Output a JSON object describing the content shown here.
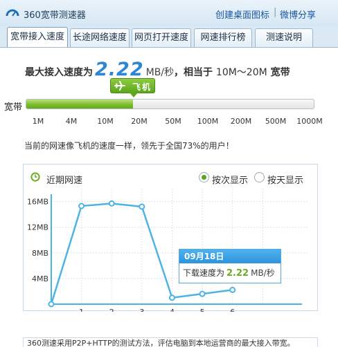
{
  "window": {
    "title": "360宽带测速器",
    "links": [
      "创建桌面图标",
      "微博分享"
    ],
    "link_separator": "|"
  },
  "tabs": [
    "宽带接入速度",
    "长途网络速度",
    "网页打开速度",
    "网速排行榜",
    "测速说明"
  ],
  "active_tab": 0,
  "summary": {
    "prefix": "最大接入速度为",
    "speed": "2.22",
    "unit": "MB/秒",
    "middle": "，相当于",
    "range": "10M～20M",
    "suffix": "宽带"
  },
  "badge": {
    "label": "飞机",
    "icon": "airplane-icon"
  },
  "bandwidth": {
    "label": "宽带",
    "scale": [
      "1M",
      "4M",
      "10M",
      "20M",
      "50M",
      "100M",
      "200M",
      "500M",
      "1000M"
    ],
    "fill_fraction": 0.371
  },
  "description": "当前的网速像飞机的速度一样，领先于全国73%的用户！",
  "chart": {
    "title": "近期网速",
    "options": [
      "按次显示",
      "按天显示"
    ],
    "selected_option": 0
  },
  "chart_data": {
    "type": "line",
    "x": [
      0,
      1,
      2,
      3,
      4,
      5,
      6
    ],
    "x_tick_labels": [
      "1",
      "2",
      "3",
      "4",
      "5",
      "6"
    ],
    "y_tick_labels": [
      "16MB",
      "12MB",
      "8MB",
      "4MB"
    ],
    "series": [
      {
        "values": [
          0,
          15.3,
          15.7,
          15.2,
          1.0,
          1.6,
          2.22
        ]
      }
    ],
    "ylim": [
      0,
      18
    ],
    "xlim": [
      0,
      8.3
    ],
    "grid": true,
    "color": "#4db3e6"
  },
  "tooltip": {
    "date": "09月18日",
    "label": "下载速度为",
    "value": "2.22",
    "unit": "MB/秒"
  },
  "footnote": "360测速采用P2P+HTTP的测试方法，评估电脑到本地运营商的最大接入带宽。"
}
